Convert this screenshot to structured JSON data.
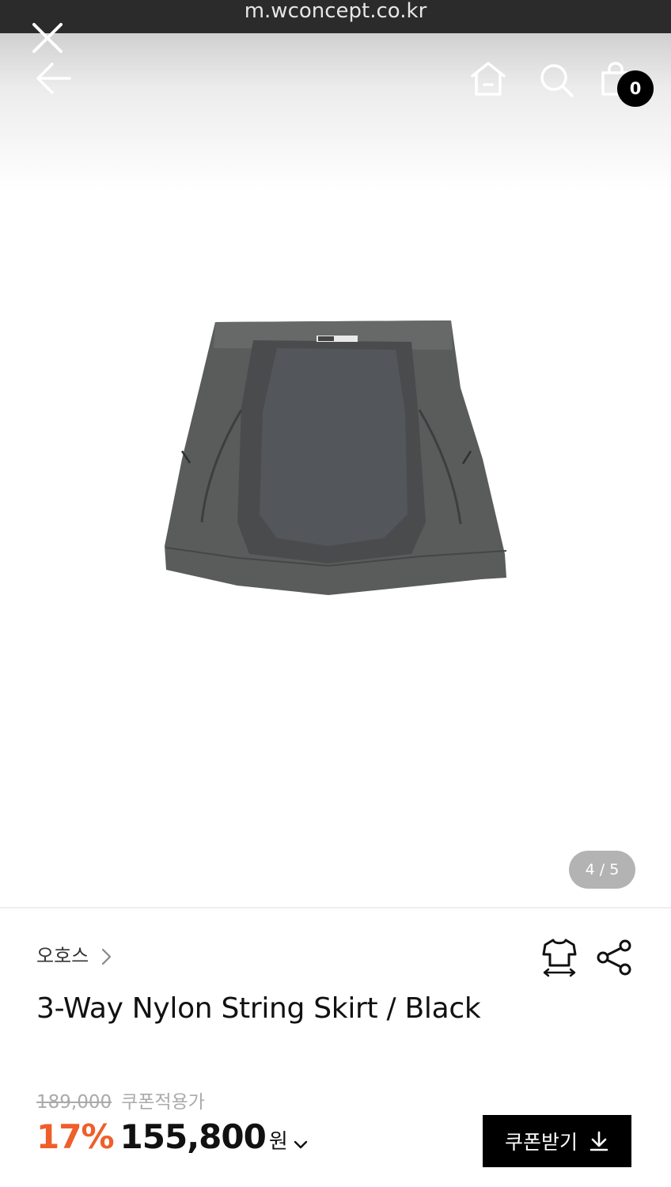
{
  "browser": {
    "url": "m.wconcept.co.kr"
  },
  "nav": {
    "close_icon": "close-icon",
    "back_icon": "arrow-left-icon",
    "home_icon": "home-icon",
    "search_icon": "search-icon",
    "cart_icon": "shopping-bag-icon",
    "cart_count": "0"
  },
  "gallery": {
    "image_alt": "3-Way Nylon String Skirt / Black",
    "indicator": "4 / 5",
    "current": 4,
    "total": 5
  },
  "product": {
    "brand": "오호스",
    "title": "3-Way Nylon String Skirt / Black",
    "original_price": "189,000",
    "coupon_note": "쿠폰적용가",
    "discount": "17%",
    "price": "155,800",
    "currency": "원",
    "size_icon": "size-guide-icon",
    "share_icon": "share-icon"
  },
  "actions": {
    "coupon_label": "쿠폰받기"
  },
  "colors": {
    "accent": "#ee5f2b",
    "button_bg": "#000000",
    "indicator_bg": "#b3b3b3"
  }
}
